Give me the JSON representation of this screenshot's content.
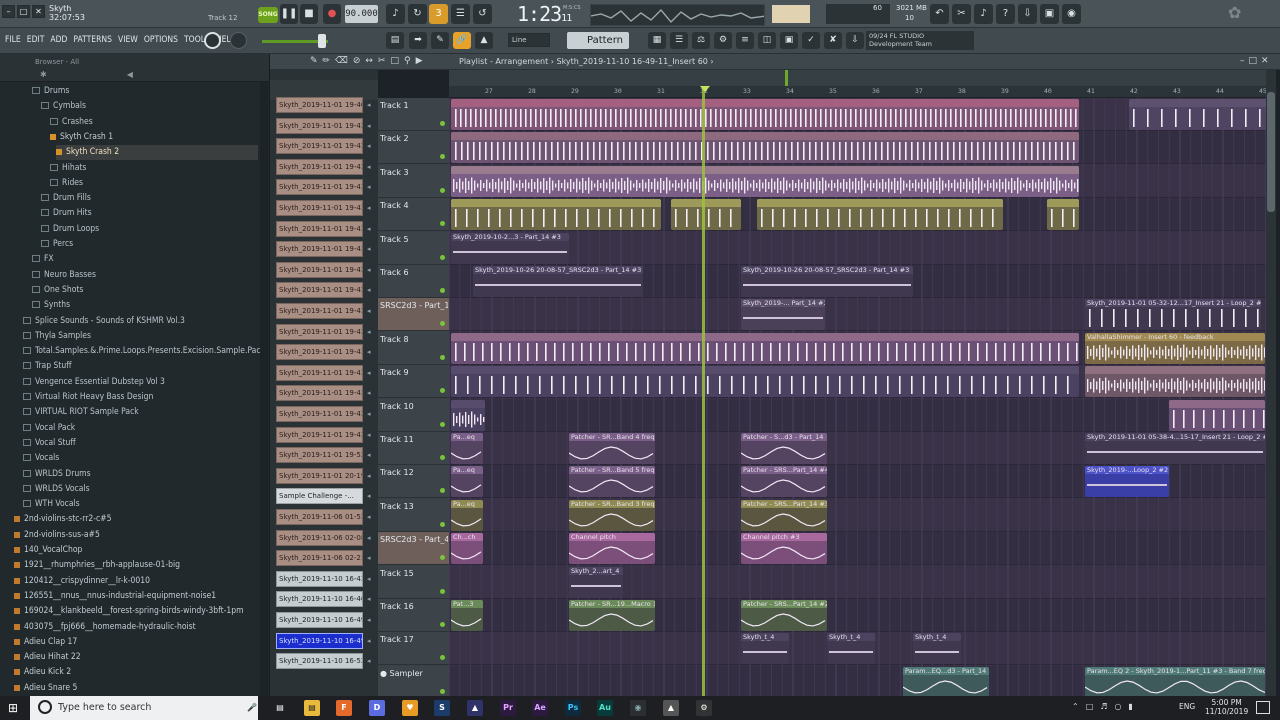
{
  "title_bar": {
    "project_name": "Skyth",
    "project_time": "32:07:53",
    "track_indicator": "Track 12",
    "song_label": "SONG",
    "bpm": "90.000",
    "time": "1:23",
    "time_sub": "11",
    "time_unit": "M:S:CS",
    "cpu": "60",
    "memory": "3021 MB",
    "polyphony": "10"
  },
  "menu": [
    "FILE",
    "EDIT",
    "ADD",
    "PATTERNS",
    "VIEW",
    "OPTIONS",
    "TOOLS",
    "HELP"
  ],
  "toolbar": {
    "snap": "Line",
    "pattern": "Pattern 1",
    "news_line1": "09/24  FL STUDIO",
    "news_line2": "Development Team"
  },
  "browser": {
    "label": "Browser - All",
    "items": [
      {
        "label": "Drums",
        "indent": 32,
        "type": "folder"
      },
      {
        "label": "Cymbals",
        "indent": 41,
        "type": "folder"
      },
      {
        "label": "Crashes",
        "indent": 50,
        "type": "folder"
      },
      {
        "label": "Skyth Crash 1",
        "indent": 50,
        "type": "file-orange"
      },
      {
        "label": "Skyth Crash 2",
        "indent": 56,
        "type": "file-orange",
        "selected": true
      },
      {
        "label": "Hihats",
        "indent": 50,
        "type": "folder"
      },
      {
        "label": "Rides",
        "indent": 50,
        "type": "folder"
      },
      {
        "label": "Drum Fills",
        "indent": 41,
        "type": "folder"
      },
      {
        "label": "Drum Hits",
        "indent": 41,
        "type": "folder"
      },
      {
        "label": "Drum Loops",
        "indent": 41,
        "type": "folder"
      },
      {
        "label": "Percs",
        "indent": 41,
        "type": "folder"
      },
      {
        "label": "FX",
        "indent": 32,
        "type": "folder"
      },
      {
        "label": "Neuro Basses",
        "indent": 32,
        "type": "folder"
      },
      {
        "label": "One Shots",
        "indent": 32,
        "type": "folder"
      },
      {
        "label": "Synths",
        "indent": 32,
        "type": "folder"
      },
      {
        "label": "Splice Sounds - Sounds of KSHMR Vol.3",
        "indent": 23,
        "type": "folder"
      },
      {
        "label": "Thyla Samples",
        "indent": 23,
        "type": "folder"
      },
      {
        "label": "Total.Samples.&.Prime.Loops.Presents.Excision.Sample.Pack",
        "indent": 23,
        "type": "folder"
      },
      {
        "label": "Trap Stuff",
        "indent": 23,
        "type": "folder"
      },
      {
        "label": "Vengence Essential Dubstep Vol 3",
        "indent": 23,
        "type": "folder"
      },
      {
        "label": "Virtual Riot Heavy Bass Design",
        "indent": 23,
        "type": "folder"
      },
      {
        "label": "VIRTUAL RIOT Sample Pack",
        "indent": 23,
        "type": "folder"
      },
      {
        "label": "Vocal Pack",
        "indent": 23,
        "type": "folder"
      },
      {
        "label": "Vocal Stuff",
        "indent": 23,
        "type": "folder"
      },
      {
        "label": "Vocals",
        "indent": 23,
        "type": "folder"
      },
      {
        "label": "WRLDS Drums",
        "indent": 23,
        "type": "folder"
      },
      {
        "label": "WRLDS Vocals",
        "indent": 23,
        "type": "folder"
      },
      {
        "label": "WTH Vocals",
        "indent": 23,
        "type": "folder"
      },
      {
        "label": "2nd-violins-stc-rr2-c#5",
        "indent": 14,
        "type": "file"
      },
      {
        "label": "2nd-violins-sus-a#5",
        "indent": 14,
        "type": "file"
      },
      {
        "label": "140_VocalChop",
        "indent": 14,
        "type": "file"
      },
      {
        "label": "1921__rhumphries__rbh-applause-01-big",
        "indent": 14,
        "type": "file"
      },
      {
        "label": "120412__crispydinner__lr-k-0010",
        "indent": 14,
        "type": "file"
      },
      {
        "label": "126551__nnus__nnus-industrial-equipment-noise1",
        "indent": 14,
        "type": "file"
      },
      {
        "label": "169024__klankbeeld__forest-spring-birds-windy-3bft-1pm",
        "indent": 14,
        "type": "file"
      },
      {
        "label": "403075__fpj666__homemade-hydraulic-hoist",
        "indent": 14,
        "type": "file"
      },
      {
        "label": "Adieu Clap 17",
        "indent": 14,
        "type": "file"
      },
      {
        "label": "Adieu Hihat 22",
        "indent": 14,
        "type": "file"
      },
      {
        "label": "Adieu Kick 2",
        "indent": 14,
        "type": "file"
      },
      {
        "label": "Adieu Snare 5",
        "indent": 14,
        "type": "file"
      },
      {
        "label": "ahh",
        "indent": 14,
        "type": "file"
      }
    ]
  },
  "picker": {
    "clips": [
      {
        "label": "Skyth_2019-11-01 19-40...",
        "style": "clip"
      },
      {
        "label": "Skyth_2019-11-01 19-43...",
        "style": "clip"
      },
      {
        "label": "Skyth_2019-11-01 19-43...",
        "style": "clip"
      },
      {
        "label": "Skyth_2019-11-01 19-43...",
        "style": "clip"
      },
      {
        "label": "Skyth_2019-11-01 19-43...",
        "style": "clip"
      },
      {
        "label": "Skyth_2019-11-01 19-43...",
        "style": "clip"
      },
      {
        "label": "Skyth_2019-11-01 19-43...",
        "style": "clip"
      },
      {
        "label": "Skyth_2019-11-01 19-43...",
        "style": "clip"
      },
      {
        "label": "Skyth_2019-11-01 19-43...",
        "style": "clip"
      },
      {
        "label": "Skyth_2019-11-01 19-43...",
        "style": "clip"
      },
      {
        "label": "Skyth_2019-11-01 19-43...",
        "style": "clip"
      },
      {
        "label": "Skyth_2019-11-01 19-43...",
        "style": "clip"
      },
      {
        "label": "Skyth_2019-11-01 19-43...",
        "style": "clip"
      },
      {
        "label": "Skyth_2019-11-01 19-43...",
        "style": "clip"
      },
      {
        "label": "Skyth_2019-11-01 19-43...",
        "style": "clip"
      },
      {
        "label": "Skyth_2019-11-01 19-43...",
        "style": "clip"
      },
      {
        "label": "Skyth_2019-11-01 19-43...",
        "style": "clip"
      },
      {
        "label": "Skyth_2019-11-01 19-52...",
        "style": "clip"
      },
      {
        "label": "Skyth_2019-11-01 20-19...",
        "style": "clip"
      },
      {
        "label": "Sample Challenge -...",
        "style": "plain"
      },
      {
        "label": "Skyth_2019-11-06 01-53...",
        "style": "clip"
      },
      {
        "label": "Skyth_2019-11-06 02-08...",
        "style": "clip"
      },
      {
        "label": "Skyth_2019-11-06 02-21...",
        "style": "clip"
      },
      {
        "label": "Skyth_2019-11-10 16-43...",
        "style": "alt"
      },
      {
        "label": "Skyth_2019-11-10 16-46...",
        "style": "alt"
      },
      {
        "label": "Skyth_2019-11-10 16-49...",
        "style": "alt"
      },
      {
        "label": "Skyth_2019-11-10 16-49...",
        "style": "sel"
      },
      {
        "label": "Skyth_2019-11-10 16-52...",
        "style": "alt"
      }
    ]
  },
  "playlist": {
    "title": "Playlist - Arrangement › Skyth_2019-11-10 16-49-11_Insert 60 ›",
    "ruler_ticks": [
      "27",
      "28",
      "29",
      "30",
      "31",
      "32",
      "33",
      "34",
      "35",
      "36",
      "37",
      "38",
      "39",
      "40",
      "41",
      "42",
      "43",
      "44",
      "45"
    ],
    "tracks": [
      {
        "name": "Track 1",
        "style": "normal"
      },
      {
        "name": "Track 2",
        "style": "normal"
      },
      {
        "name": "Track 3",
        "style": "normal"
      },
      {
        "name": "Track 4",
        "style": "normal"
      },
      {
        "name": "Track 5",
        "style": "normal"
      },
      {
        "name": "Track 6",
        "style": "normal"
      },
      {
        "name": "SRSC2d3 - Part_14",
        "style": "alt"
      },
      {
        "name": "Track 8",
        "style": "normal"
      },
      {
        "name": "Track 9",
        "style": "normal"
      },
      {
        "name": "Track 10",
        "style": "normal"
      },
      {
        "name": "Track 11",
        "style": "normal"
      },
      {
        "name": "Track 12",
        "style": "normal"
      },
      {
        "name": "Track 13",
        "style": "normal"
      },
      {
        "name": "SRSC2d3 - Part_4 #3",
        "style": "alt"
      },
      {
        "name": "Track 15",
        "style": "normal"
      },
      {
        "name": "Track 16",
        "style": "normal"
      },
      {
        "name": "Track 17",
        "style": "normal"
      },
      {
        "name": "● Sampler",
        "style": "normal"
      }
    ],
    "clip_labels": {
      "t5": "Skyth_2019-10-2...3 - Part_14 #3",
      "t6": "Skyth_2019-10-26 20-08-57_SRSC2d3 - Part_14 #3",
      "t6b": "Skyth_2019-10-26 20-08-57_SRSC2d3 - Part_14 #3",
      "t7": "Skyth_2019-... Part_14 #3",
      "t7b": "Skyth_2019-11-01 05-32-12...17_Insert 21 - Loop_2 #2",
      "t8": "ValhallaShimmer - Insert 60 - feedback",
      "t11a": "Pa...eq",
      "t11b": "Patcher - SR...Band 4 freq",
      "t11c": "Patcher - S...d3 - Part_14",
      "t11d": "Skyth_2019-11-01 05-38-4...15-17_Insert 21 - Loop_2 #2",
      "t12a": "Pa...eq",
      "t12b": "Patcher - SR...Band 5 freq",
      "t12c": "Patcher - SRS...Part_14 #4",
      "t12d": "Skyth_2019-...Loop_2 #2",
      "t13a": "Pa...eq",
      "t13b": "Patcher - SR...Band 3 freq",
      "t13c": "Patcher - SRS...Part_14 #3",
      "t14a": "Ch...ch",
      "t14b": "Channel pitch",
      "t14c": "Channel pitch #3",
      "t15": "Skyth_2...art_4",
      "t16a": "Pat...3",
      "t16b": "Patcher - SR...19...Macro 1",
      "t16c": "Patcher - SRS...Part_14 #2",
      "t17a": "Skyth_t_4",
      "t17b": "Skyth_t_4",
      "t17c": "Skyth_t_4",
      "t18a": "Param...EQ...d3 - Part_14",
      "t18b": "Param...EQ 2 - Skyth_2019-1...Part_11 #3 - Band 7 freq"
    }
  },
  "taskbar": {
    "search_placeholder": "Type here to search",
    "lang": "ENG",
    "time": "5:00 PM",
    "date": "11/10/2019"
  },
  "colors": {
    "accent_green": "#6da31c",
    "playlist_bg": "#3a3348",
    "clip_pink": "#8b6a8a",
    "clip_header": "#b58aa9",
    "clip_olive": "#8e8a52",
    "clip_violet": "#6f5c86",
    "selection_blue": "#1b2dcc",
    "link_orange": "#e7a22a"
  }
}
